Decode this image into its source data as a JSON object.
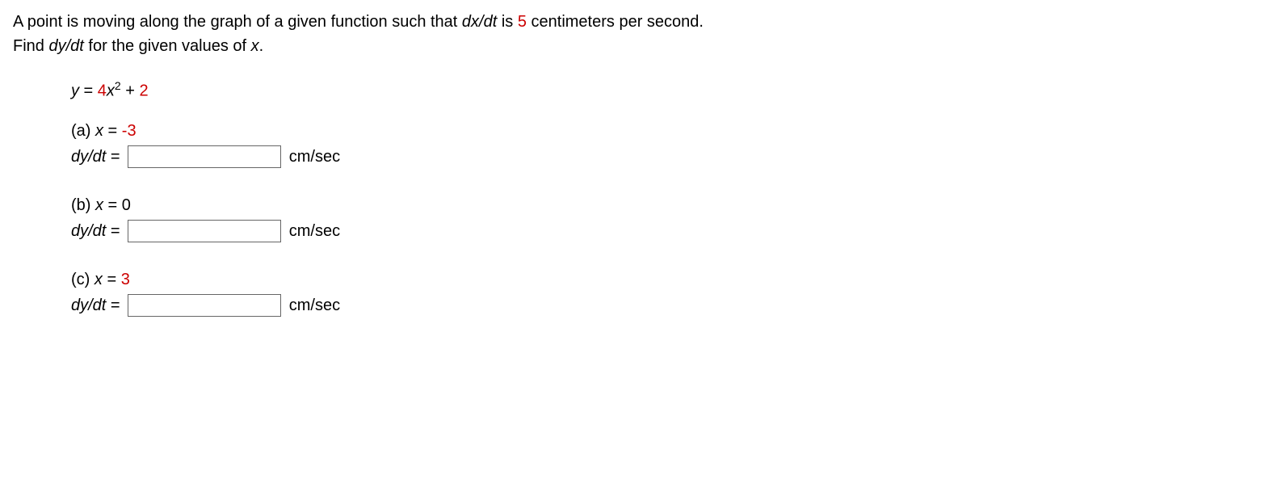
{
  "prompt": {
    "line1_part1": "A point is moving along the graph of a given function such that ",
    "dxdt": "dx/dt",
    "line1_part2": " is ",
    "rate_value": "5",
    "line1_part3": " centimeters per second.",
    "line2_part1": "Find ",
    "dydt": "dy/dt",
    "line2_part2": " for the given values of ",
    "x_var": "x",
    "line2_part3": "."
  },
  "equation": {
    "y_eq": "y",
    "eq_sign": " = ",
    "coef": "4",
    "xvar": "x",
    "exp": "2",
    "plus": " + ",
    "const": "2"
  },
  "parts": {
    "a": {
      "label": "(a) ",
      "xvar": "x",
      "eq": " = ",
      "value": "-3",
      "dydt": "dy/dt",
      "eq2": " =",
      "unit": "cm/sec"
    },
    "b": {
      "label": "(b) ",
      "xvar": "x",
      "eq": " = ",
      "value": "0",
      "dydt": "dy/dt",
      "eq2": " =",
      "unit": "cm/sec"
    },
    "c": {
      "label": "(c) ",
      "xvar": "x",
      "eq": " = ",
      "value": "3",
      "dydt": "dy/dt",
      "eq2": " =",
      "unit": "cm/sec"
    }
  }
}
